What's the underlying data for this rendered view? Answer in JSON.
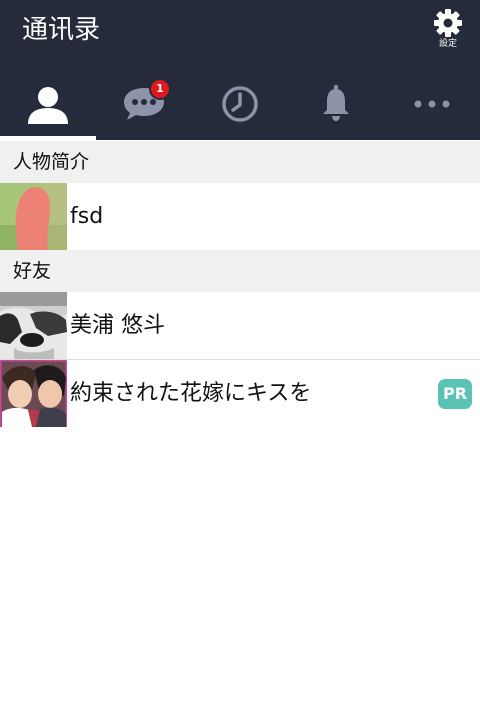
{
  "header": {
    "title": "通讯录",
    "settings_label": "設定"
  },
  "tabs": [
    {
      "name": "contacts",
      "icon": "person-icon",
      "active": true
    },
    {
      "name": "chats",
      "icon": "chat-bubble-icon",
      "badge": "1"
    },
    {
      "name": "history",
      "icon": "clock-icon"
    },
    {
      "name": "notifications",
      "icon": "bell-icon"
    },
    {
      "name": "more",
      "icon": "more-dots-icon"
    }
  ],
  "sections": {
    "profile_label": "人物简介",
    "friends_label": "好友"
  },
  "profile": {
    "name": "fsd"
  },
  "friends": [
    {
      "name": "美浦 悠斗"
    },
    {
      "name": "約束された花嫁にキスを",
      "tag": "PR"
    }
  ],
  "colors": {
    "header_bg": "#252b3b",
    "badge_red": "#e0191f",
    "pr_teal": "#5bc3b3",
    "section_bg": "#f0f0f0"
  }
}
